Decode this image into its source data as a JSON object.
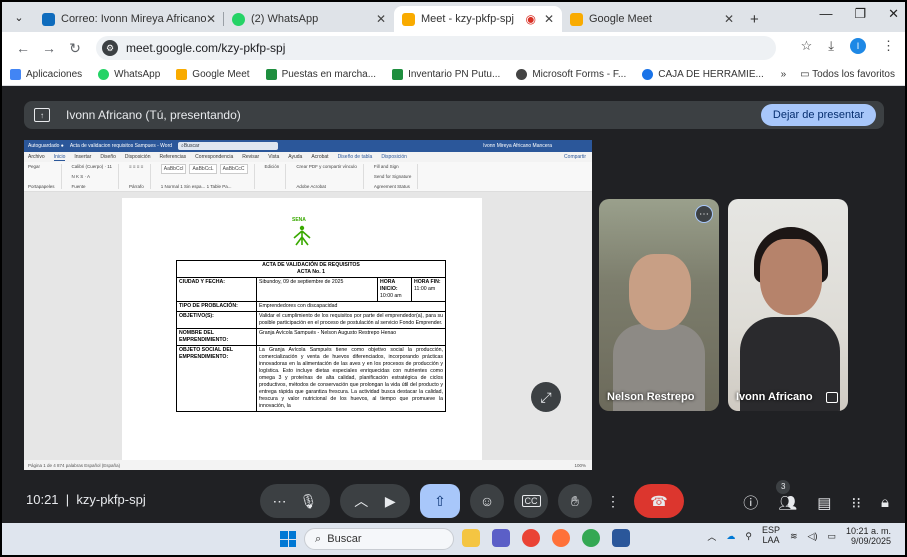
{
  "browser": {
    "tabs": [
      {
        "title": "Correo: Ivonn Mireya Africano",
        "fav_color": "#0f6cbd",
        "active": false
      },
      {
        "title": "(2) WhatsApp",
        "fav_color": "#25d366",
        "active": false
      },
      {
        "title": "Meet - kzy-pkfp-spj",
        "fav_color": "#f9ab00",
        "active": true
      },
      {
        "title": "Google Meet",
        "fav_color": "#f9ab00",
        "active": false
      }
    ],
    "url": "meet.google.com/kzy-pkfp-spj",
    "profile_initial": "I",
    "bookmarks": [
      {
        "label": "Aplicaciones",
        "color": "#4285f4"
      },
      {
        "label": "WhatsApp",
        "color": "#25d366"
      },
      {
        "label": "Google Meet",
        "color": "#f9ab00"
      },
      {
        "label": "Puestas en marcha...",
        "color": "#1e8e3e"
      },
      {
        "label": "Inventario PN Putu...",
        "color": "#1e8e3e"
      },
      {
        "label": "Microsoft Forms - F...",
        "color": "#444444"
      },
      {
        "label": "CAJA DE HERRAMIE...",
        "color": "#1a73e8"
      }
    ],
    "all_bookmarks": "Todos los favoritos"
  },
  "meet": {
    "presenting_label": "Ivonn Africano (Tú, presentando)",
    "stop_presenting": "Dejar de presentar",
    "participants": [
      {
        "name": "Nelson Restrepo"
      },
      {
        "name": "Ivonn Africano"
      }
    ],
    "time": "10:21",
    "meeting_code": "kzy-pkfp-spj",
    "participant_count": "3"
  },
  "word": {
    "title": "Acta de validacion requisitos Sampues - Word",
    "search": "Buscar",
    "user": "Ivonn Mireya Africano Mancera",
    "menus": [
      "Archivo",
      "Inicio",
      "Insertar",
      "Diseño",
      "Disposición",
      "Referencias",
      "Correspondencia",
      "Revisar",
      "Vista",
      "Ayuda",
      "Acrobat",
      "Diseño de tabla",
      "Disposición"
    ],
    "share": "Compartir",
    "font": "Calibri (Cuerpo)",
    "font_size": "11",
    "styles": [
      "1 Normal",
      "1 Sin espa...",
      "1 Table Pa..."
    ],
    "status": "Página 1 de 4   874 palabras   Español (España)",
    "zoom": "100%"
  },
  "doc": {
    "logo_text": "SENA",
    "heading1": "ACTA DE VALIDACIÓN DE REQUISITOS",
    "heading2": "ACTA No. 1",
    "city_label": "CIUDAD Y FECHA:",
    "city_value": "Sibundoy, 09 de septiembre de 2025",
    "start_label": "HORA INICIO:",
    "start_value": "10:00 am",
    "end_label": "HORA FIN:",
    "end_value": "11:00 am",
    "pop_label": "TIPO DE PROBLACIÓN:",
    "pop_value": "Emprendedores con discapacidad",
    "obj_label": "OBJETIVO(S):",
    "obj_value": "Validar el cumplimiento de los requisitos por parte del emprendedor(a), para su posible participación en el proceso de postulación al servicio Fondo Emprender.",
    "name_label": "NOMBRE DEL EMPRENDIMIENTO:",
    "name_value": "Granja Avícola Sampués - Nelson Augusto Restrepo Henao",
    "social_label": "OBJETO SOCIAL DEL EMPRENDIMIENTO:",
    "social_value": "La Granja Avícola Sampués tiene como objetivo social la producción, comercialización y venta de huevos diferenciados, incorporando prácticas innovadoras en la alimentación de las aves y en los procesos de producción y logística. Esto incluye dietas especiales enriquecidas con nutrientes como omega 3 y proteínas de alta calidad, planificación estratégica de ciclos productivos, métodos de conservación que prolongan la vida útil del producto y entrega rápida que garantiza frescura. La actividad busca destacar la calidad, frescura y valor nutricional de los huevos, al tiempo que promueve la innovación, la"
  },
  "taskbar": {
    "search": "Buscar",
    "lang1": "ESP",
    "lang2": "LAA",
    "time": "10:21 a. m.",
    "date": "9/09/2025"
  }
}
